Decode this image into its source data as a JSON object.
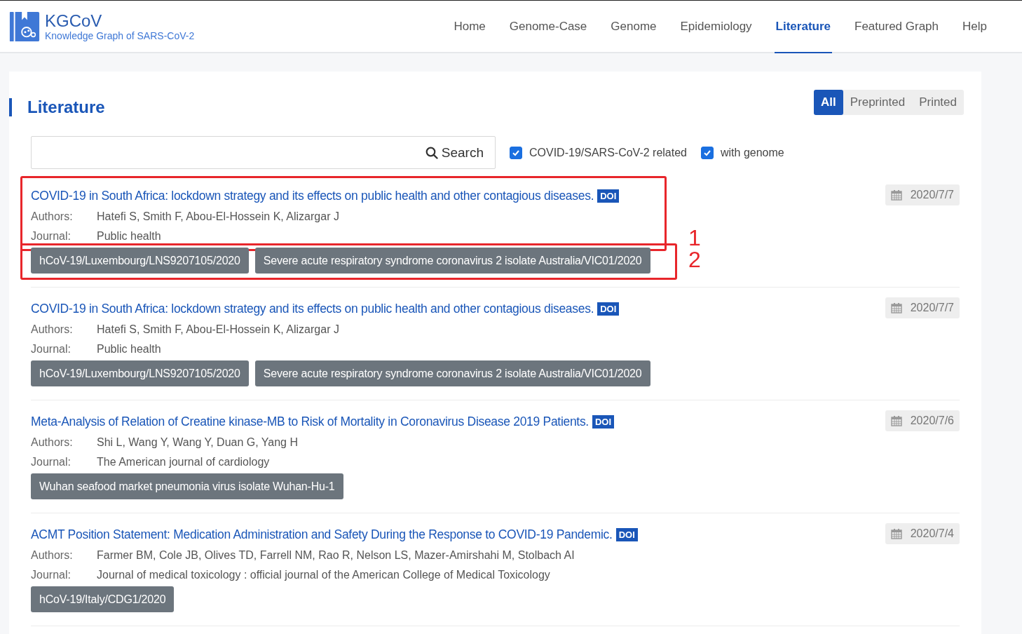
{
  "header": {
    "logo_title": "KGCoV",
    "logo_subtitle": "Knowledge Graph of SARS-CoV-2",
    "nav": [
      {
        "label": "Home",
        "selected": false
      },
      {
        "label": "Genome-Case",
        "selected": false
      },
      {
        "label": "Genome",
        "selected": false
      },
      {
        "label": "Epidemiology",
        "selected": false
      },
      {
        "label": "Literature",
        "selected": true
      },
      {
        "label": "Featured Graph",
        "selected": false
      },
      {
        "label": "Help",
        "selected": false
      }
    ]
  },
  "page": {
    "title": "Literature",
    "filter_tabs": [
      {
        "label": "All",
        "selected": true
      },
      {
        "label": "Preprinted",
        "selected": false
      },
      {
        "label": "Printed",
        "selected": false
      }
    ],
    "search": {
      "button": "Search"
    },
    "checkboxes": [
      {
        "label": "COVID-19/SARS-CoV-2 related",
        "checked": true
      },
      {
        "label": "with genome",
        "checked": true
      }
    ],
    "items": [
      {
        "title": "COVID-19 in South Africa: lockdown strategy and its effects on public health and other contagious diseases.",
        "doi": "DOI",
        "date": "2020/7/7",
        "authors_label": "Authors:",
        "authors": "Hatefi S, Smith F, Abou-El-Hossein K, Alizargar J",
        "journal_label": "Journal:",
        "journal": "Public health",
        "tags": [
          "hCoV-19/Luxembourg/LNS9207105/2020",
          "Severe acute respiratory syndrome coronavirus 2 isolate Australia/VIC01/2020"
        ],
        "details_marker": "1",
        "tags_marker": "2"
      },
      {
        "title": "COVID-19 in South Africa: lockdown strategy and its effects on public health and other contagious diseases.",
        "doi": "DOI",
        "date": "2020/7/7",
        "authors_label": "Authors:",
        "authors": "Hatefi S, Smith F, Abou-El-Hossein K, Alizargar J",
        "journal_label": "Journal:",
        "journal": "Public health",
        "tags": [
          "hCoV-19/Luxembourg/LNS9207105/2020",
          "Severe acute respiratory syndrome coronavirus 2 isolate Australia/VIC01/2020"
        ]
      },
      {
        "title": "Meta-Analysis of Relation of Creatine kinase-MB to Risk of Mortality in Coronavirus Disease 2019 Patients.",
        "doi": "DOI",
        "date": "2020/7/6",
        "authors_label": "Authors:",
        "authors": "Shi L, Wang Y, Wang Y, Duan G, Yang H",
        "journal_label": "Journal:",
        "journal": "The American journal of cardiology",
        "tags": [
          "Wuhan seafood market pneumonia virus isolate Wuhan-Hu-1"
        ]
      },
      {
        "title": "ACMT Position Statement: Medication Administration and Safety During the Response to COVID-19 Pandemic.",
        "doi": "DOI",
        "date": "2020/7/4",
        "authors_label": "Authors:",
        "authors": "Farmer BM, Cole JB, Olives TD, Farrell NM, Rao R, Nelson LS, Mazer-Amirshahi M, Stolbach AI",
        "journal_label": "Journal:",
        "journal": "Journal of medical toxicology : official journal of the American College of Medical Toxicology",
        "tags": [
          "hCoV-19/Italy/CDG1/2020"
        ]
      }
    ]
  }
}
